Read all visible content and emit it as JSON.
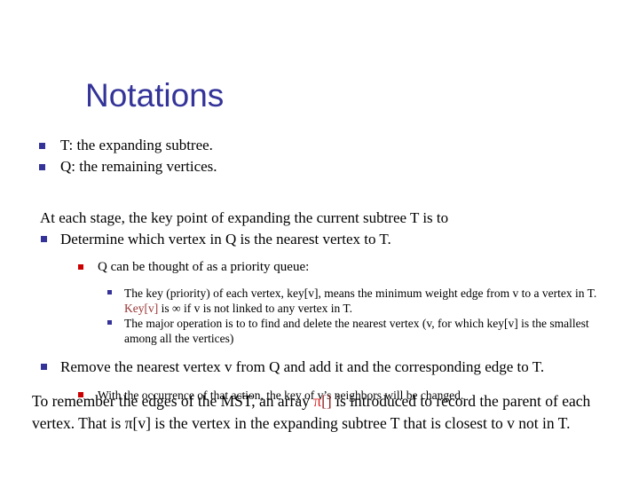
{
  "slide": {
    "title": "Notations",
    "title_color": "#333399",
    "background": "#ffffff",
    "bullet_colors": {
      "level1": "#333399",
      "level2": "#333399",
      "level3": "#cc0000",
      "level4": "#333399",
      "level4_alt": "#cc0000"
    },
    "level1_items": [
      {
        "text": "T: the expanding subtree."
      },
      {
        "text": "Q: the remaining vertices."
      }
    ],
    "stage_intro": "At each stage, the key point of expanding the current subtree T is to",
    "determine_item": "Determine which vertex in Q is the nearest vertex to T.",
    "priority_queue_item": "Q can be thought of as  a priority queue:",
    "queue_details": [
      {
        "part1": "The key (priority) of each vertex, key[v], means the minimum weight edge from v to a vertex in T. ",
        "accent": "Key[v]",
        "part2": " is ∞ if v is not linked to any vertex in T."
      },
      {
        "part1": "The major operation is to to find and delete the nearest vertex (v, for which key[v] is the smallest among all the vertices)",
        "accent": "",
        "part2": ""
      }
    ],
    "remove_item": "Remove the nearest vertex v from Q and add it and the corresponding edge to T.",
    "remove_detail": "With the occurrence of that action, the key of v’s neighbors will be changed.",
    "closing": {
      "part1": "To remember the edges of the MST, an array ",
      "pi_symbol": "π",
      "brackets": "[]",
      "part2": " is introduced to record the parent of each vertex. That is π[v] is the vertex in the expanding subtree T that is closest to v not in T."
    }
  }
}
